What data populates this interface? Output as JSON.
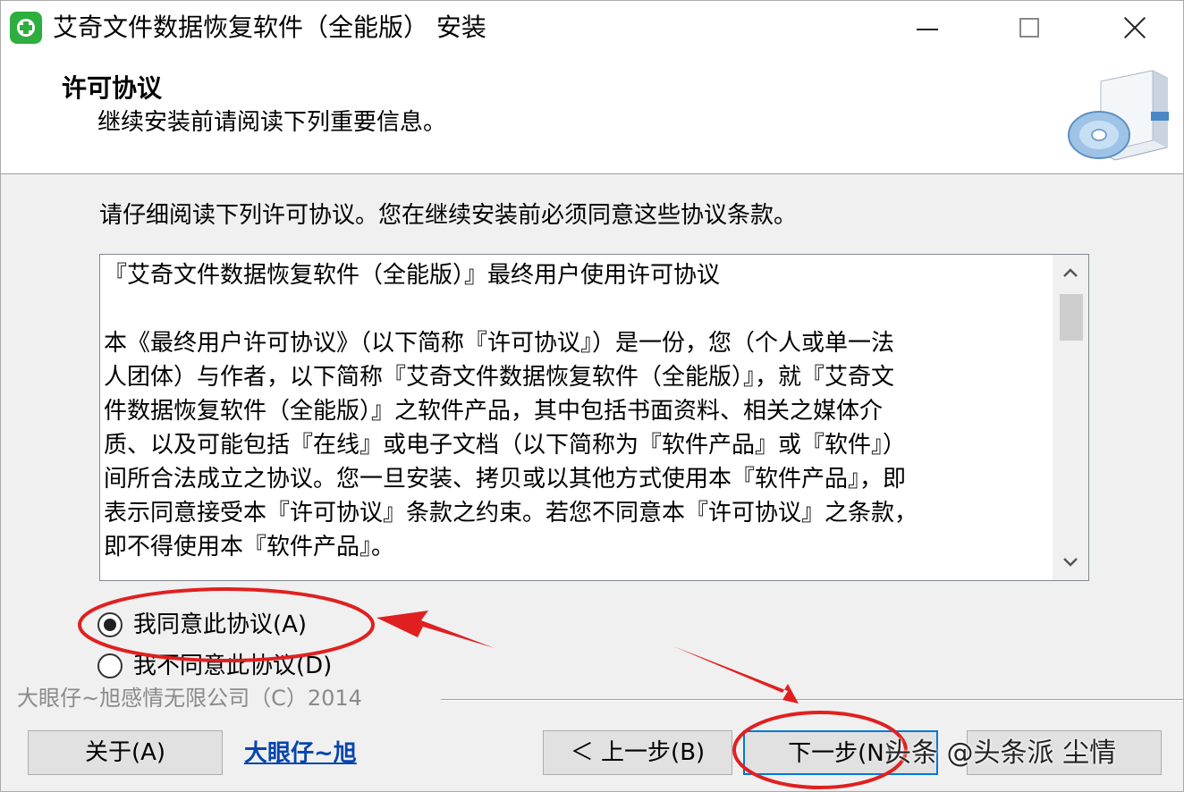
{
  "window": {
    "title": "艾奇文件数据恢复软件（全能版） 安装"
  },
  "header": {
    "title": "许可协议",
    "subtitle": "继续安装前请阅读下列重要信息。"
  },
  "body": {
    "instruction": "请仔细阅读下列许可协议。您在继续安装前必须同意这些协议条款。",
    "license": {
      "heading": "『艾奇文件数据恢复软件（全能版）』最终用户使用许可协议",
      "lines": [
        "本《最终用户许可协议》（以下简称『许可协议』）是一份，您（个人或单一法",
        "人团体）与作者，以下简称『艾奇文件数据恢复软件（全能版）』，就『艾奇文",
        "件数据恢复软件（全能版）』之软件产品，其中包括书面资料、相关之媒体介",
        "质、以及可能包括『在线』或电子文档（以下简称为『软件产品』或『软件』）",
        "间所合法成立之协议。您一旦安装、拷贝或以其他方式使用本『软件产品』，即",
        "表示同意接受本『许可协议』条款之约束。若您不同意本『许可协议』之条款，",
        "即不得使用本『软件产品』。"
      ]
    },
    "radio_agree": "我同意此协议(A)",
    "radio_disagree": "我不同意此协议(D)",
    "agree_selected": true
  },
  "footer": {
    "copyright": "大眼仔~旭感情无限公司（C）2014",
    "about_label": "关于(A)",
    "author_link": "大眼仔~旭",
    "back_label": "＜ 上一步(B)",
    "next_label": "下一步(N)",
    "cancel_label": ""
  },
  "watermark": "头条 @头条派 尘情",
  "colors": {
    "annotation": "#e02020",
    "link": "#0645ad",
    "focus": "#0078d7"
  }
}
